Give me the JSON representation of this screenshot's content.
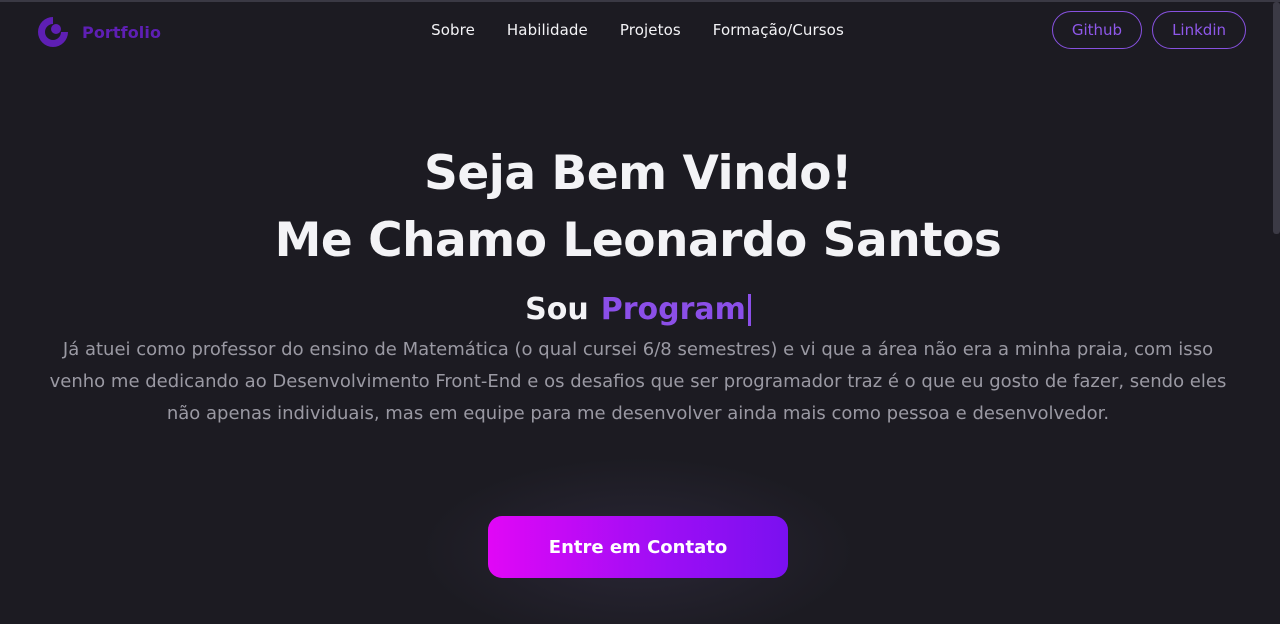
{
  "brand": {
    "logo_icon": "portfolio-logo-icon",
    "name": "Portfolio",
    "color": "#5e1fb4"
  },
  "nav": {
    "links": [
      "Sobre",
      "Habilidade",
      "Projetos",
      "Formação/Cursos"
    ],
    "actions": [
      "Github",
      "Linkdin"
    ]
  },
  "hero": {
    "title_line1": "Seja Bem Vindo!",
    "title_line2": "Me Chamo Leonardo Santos",
    "prefix": "Sou",
    "typed_text": "Program",
    "description": "Já atuei como professor do ensino de Matemática (o qual cursei 6/8 semestres) e vi que a área não era a minha praia, com isso venho me dedicando ao Desenvolvimento Front-End e os desafios que ser programador traz é o que eu gosto de fazer, sendo eles não apenas individuais, mas em equipe para me desenvolver ainda mais como pessoa e desenvolvedor.",
    "cta_label": "Entre em Contato"
  },
  "colors": {
    "background": "#1c1b22",
    "accent": "#8b4fe8",
    "cta_gradient_start": "#e107f6",
    "cta_gradient_end": "#7a10f0"
  }
}
